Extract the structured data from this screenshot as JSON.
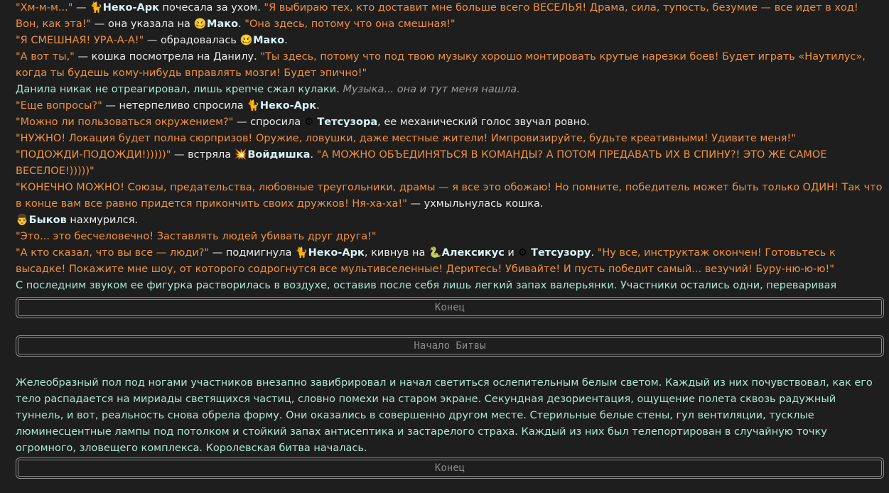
{
  "lines": {
    "l1_a": "\"Хм-м-м...\"",
    "l1_b": " — ",
    "l1_name": "Неко-Арк",
    "l1_c": " почесала за ухом. ",
    "l1_d": "\"Я выбираю тех, кто доставит мне больше всего ВЕСЕЛЬЯ! Драма, сила, тупость, безумие — все идет в ход! Вон, как эта!\"",
    "l1_e": " — она указала на ",
    "l1_name2": "Мако",
    "l1_f": ". ",
    "l1_g": "\"Она здесь, потому что она смешная!\"",
    "l2_a": "\"Я СМЕШНАЯ! УРА-А-А!\"",
    "l2_b": " — обрадовалась ",
    "l2_name": "Мако",
    "l2_c": ".",
    "l3_a": "\"А вот ты,\"",
    "l3_b": " — кошка посмотрела на Данилу. ",
    "l3_c": "\"Ты здесь, потому что под твою музыку хорошо монтировать крутые нарезки боев! Будет играть «Наутилус», когда ты будешь кому-нибудь вправлять мозги! Будет эпично!\"",
    "l4_a": "Данила никак не отреагировал, лишь крепче сжал кулаки. ",
    "l4_b": "Музыка... она и тут меня нашла.",
    "l5_a": "\"Еще вопросы?\"",
    "l5_b": " — нетерпеливо спросила ",
    "l5_name": "Неко-Арк",
    "l5_c": ".",
    "l6_a": "\"Можно ли пользоваться окружением?\"",
    "l6_b": " — спросила ",
    "l6_name": "Тетсузора",
    "l6_c": ", ее механический голос звучал ровно.",
    "l7_a": "\"НУЖНО! Локация будет полна сюрпризов! Оружие, ловушки, даже местные жители! Импровизируйте, будьте креативными! Удивите меня!\"",
    "l8_a": "\"ПОДОЖДИ-ПОДОЖДИ!)))))\"",
    "l8_b": " — встряла ",
    "l8_name": "Войдишка",
    "l8_c": ". ",
    "l8_d": "\"А МОЖНО ОБЪЕДИНЯТЬСЯ В КОМАНДЫ? А ПОТОМ ПРЕДАВАТЬ ИХ В СПИНУ?! ЭТО ЖЕ САМОЕ ВЕСЕЛОЕ!)))))\"",
    "l9_a": "\"КОНЕЧНО МОЖНО! Союзы, предательства, любовные треугольники, драмы — я все это обожаю! Но помните, победитель может быть только ОДИН! Так что в конце вам все равно придется прикончить своих дружков! Ня-ха-ха!\"",
    "l9_b": " — ухмыльнулась кошка.",
    "l10_name": "Быков",
    "l10_a": " нахмурился.",
    "l11_a": "\"Это... это бесчеловечно! Заставлять людей убивать друг друга!\"",
    "l12_a": "\"А кто сказал, что вы все — люди?\"",
    "l12_b": " — подмигнула ",
    "l12_name": "Неко-Арк",
    "l12_c": ", кивнув на ",
    "l12_name2": "Алексикус",
    "l12_d": " и ",
    "l12_name3": "Тетсузору",
    "l12_e": ". ",
    "l12_f": "\"Ну все, инструктаж окончен! Готовьтесь к высадке! Покажите мне шоу, от которого содрогнутся все мультивселенные! Деритесь! Убивайте! И пусть победит самый... везучий! Буру-ню-ю-ю!\"",
    "l13_a": "С последним звуком ее фигурка растворилась в воздухе, оставив после себя лишь легкий запах валерьянки. Участники остались одни, переваривая услышанное. Напряжение в зале стало почти осязаемым. Теперь все они знали правила. И все они знали, что только один выйдет отсюда живым."
  },
  "emoji": {
    "cat": "🐈",
    "mako": "🥴",
    "gear": "⚙",
    "boom": "💥",
    "person": "👨",
    "snake": "🐍"
  },
  "buttons": {
    "end1": "Конец",
    "battle": "Начало Битвы",
    "end2": "Конец"
  },
  "block2": "Желеобразный пол под ногами участников внезапно завибрировал и начал светиться ослепительным белым светом. Каждый из них почувствовал, как его тело распадается на мириады светящихся частиц, словно помехи на старом экране. Секундная дезориентация, ощущение полета сквозь радужный туннель, и вот, реальность снова обрела форму. Они оказались в совершенно другом месте. Стерильные белые стены, гул вентиляции, тусклые люминесцентные лампы под потолком и стойкий запах антисептика и застарелого страха. Каждый из них был телепортирован в случайную точку огромного, зловещего комплекса. Королевская битва началась."
}
